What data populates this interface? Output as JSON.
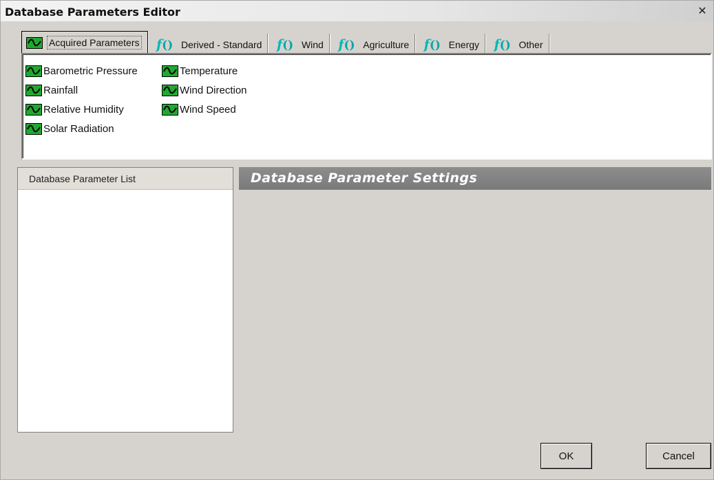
{
  "window": {
    "title": "Database Parameters Editor",
    "close_glyph": "✕"
  },
  "tabs": [
    {
      "label": "Acquired Parameters",
      "icon": "wave-icon",
      "active": true
    },
    {
      "label": "Derived - Standard",
      "icon": "function-icon",
      "active": false
    },
    {
      "label": "Wind",
      "icon": "function-icon",
      "active": false
    },
    {
      "label": "Agriculture",
      "icon": "function-icon",
      "active": false
    },
    {
      "label": "Energy",
      "icon": "function-icon",
      "active": false
    },
    {
      "label": "Other",
      "icon": "function-icon",
      "active": false
    }
  ],
  "parameters": {
    "column1": [
      "Barometric Pressure",
      "Rainfall",
      "Relative Humidity",
      "Solar Radiation"
    ],
    "column2": [
      "Temperature",
      "Wind Direction",
      "Wind Speed"
    ]
  },
  "list_panel": {
    "header": "Database Parameter List"
  },
  "settings_panel": {
    "header": "Database Parameter Settings"
  },
  "buttons": {
    "ok": "OK",
    "cancel": "Cancel"
  },
  "colors": {
    "wave_icon_green": "#20a830",
    "function_icon_teal": "#00b8b8",
    "settings_header_bg": "#828282"
  }
}
